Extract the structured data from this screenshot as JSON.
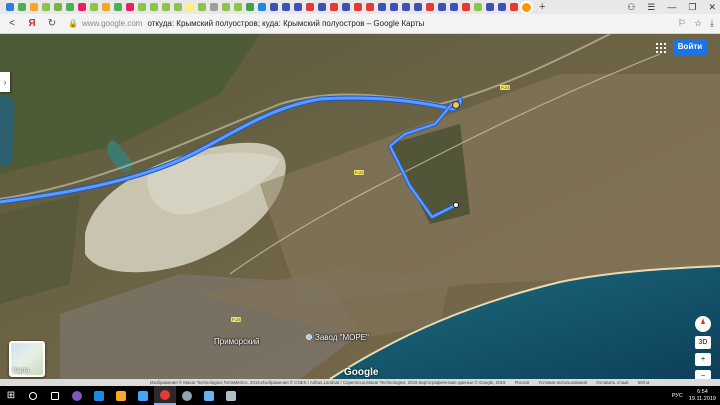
{
  "browser": {
    "tab_colors": [
      "#2b7de0",
      "#4caf50",
      "#f5a623",
      "#8bc34a",
      "#7cb342",
      "#4caf50",
      "#e91e63",
      "#8bc34a",
      "#f5a623",
      "#4caf50",
      "#e91e63",
      "#8bc34a",
      "#8bc34a",
      "#8bc34a",
      "#8bc34a",
      "#fff176",
      "#8bc34a",
      "#9e9e9e",
      "#8bc34a",
      "#8bc34a",
      "#43a047",
      "#1e88e5",
      "#3f51b5",
      "#3f51b5",
      "#3f51b5",
      "#e53935",
      "#3f51b5",
      "#e53935",
      "#3f51b5",
      "#e53935",
      "#e53935",
      "#3f51b5",
      "#3f51b5",
      "#3f51b5",
      "#3f51b5",
      "#e53935",
      "#3f51b5",
      "#3f51b5",
      "#e53935",
      "#8bc34a",
      "#3f51b5",
      "#3f51b5",
      "#e53935",
      "#ff9800"
    ],
    "new_tab": "+",
    "window_controls": [
      "⚇",
      "☰",
      "—",
      "❐",
      "✕"
    ],
    "back": "<",
    "yandex": "Я",
    "reload": "↻",
    "url_domain": "www.google.com",
    "url_title": "откуда: Крымский полуостров; куда: Крымский полуостров – Google Карты",
    "addr_icons": [
      "⚐",
      "☆",
      "⤓"
    ]
  },
  "map": {
    "signin_label": "Войти",
    "layer_label": "Карта",
    "google_label": "Google",
    "labels": {
      "town": "Приморский",
      "factory": "Завод \"МОРЕ\""
    },
    "road_badges": [
      "Р-23",
      "Р-23",
      "Р-23"
    ],
    "controls": {
      "view_3d": "3D",
      "zoom_in": "+",
      "zoom_out": "−"
    }
  },
  "attribution": {
    "items": [
      "Изображения © Maxar Technologies,TerraMetrics, 2019,Изображения © CNES / Airbus,Landsat / Copernicus,Maxar Technologies, 2019,Картографические данные © Google, 2019",
      "Россия",
      "Условия использования",
      "Оставить отзыв",
      "500 м"
    ]
  },
  "taskbar": {
    "start": "⊞",
    "icons": [
      {
        "name": "search-icon",
        "color": "#ffffff"
      },
      {
        "name": "task-view-icon",
        "color": "#ffffff"
      },
      {
        "name": "tor-browser-icon",
        "color": "#7e57c2"
      },
      {
        "name": "edge-icon",
        "color": "#1e88e5"
      },
      {
        "name": "explorer-icon",
        "color": "#f9a825"
      },
      {
        "name": "store-icon",
        "color": "#42a5f5"
      },
      {
        "name": "yandex-browser-icon",
        "color": "#e53935"
      },
      {
        "name": "steam-icon",
        "color": "#90a4ae"
      },
      {
        "name": "mail-icon",
        "color": "#64b5f6"
      },
      {
        "name": "app-icon",
        "color": "#b0bec5"
      }
    ],
    "language": "РУС",
    "time": "6:54",
    "date": "19.11.2019"
  }
}
